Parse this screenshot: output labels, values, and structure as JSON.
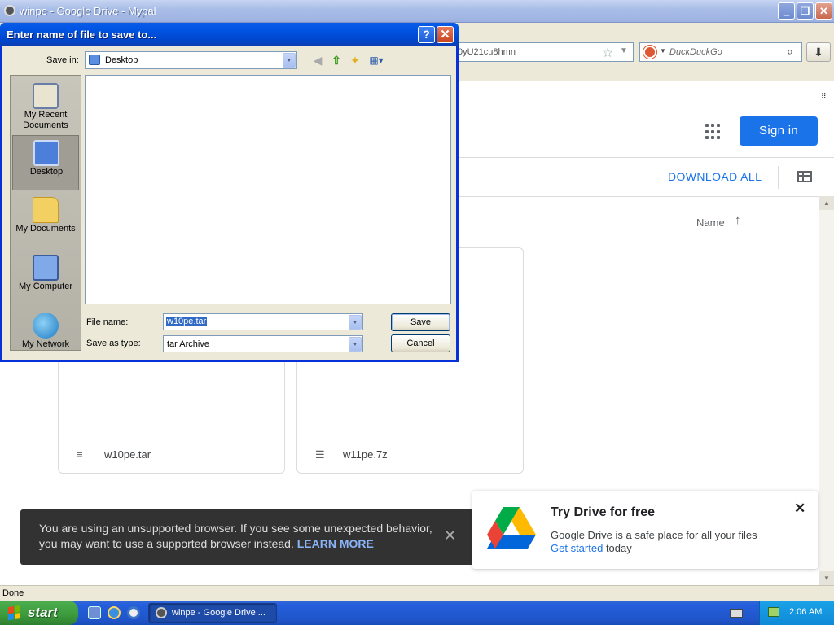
{
  "browser": {
    "title": "winpe - Google Drive - Mypal",
    "minimize_icon": "minimize-icon",
    "maximize_icon": "maximize-icon",
    "close_icon": "close-icon",
    "url_partial": "0yU21cu8hmn",
    "search_placeholder": "DuckDuckGo",
    "status_text": "Done"
  },
  "drive": {
    "signin_label": "Sign in",
    "download_all_label": "DOWNLOAD ALL",
    "sort_label": "Name",
    "sort_arrow": "↑",
    "files": [
      {
        "name": "w10pe.tar",
        "icon": "archive-icon"
      },
      {
        "name": "w11pe.7z",
        "icon": "list-file-icon"
      }
    ],
    "toast": {
      "text": "You are using an unsupported browser. If you see some unexpected behavior, you may want to use a supported browser instead.",
      "link": "LEARN MORE",
      "close": "✕"
    },
    "promo": {
      "title": "Try Drive for free",
      "description": "Google Drive is a safe place for all your files",
      "link": "Get started",
      "link_suffix": "today",
      "close": "✕",
      "logo_colors": [
        "#0066da",
        "#00ac47",
        "#ea4335",
        "#ffba00"
      ]
    }
  },
  "dialog": {
    "title": "Enter name of file to save to...",
    "help": "?",
    "close": "✕",
    "save_in_label": "Save in:",
    "save_in_value": "Desktop",
    "places": [
      {
        "label": "My Recent Documents",
        "selected": false
      },
      {
        "label": "Desktop",
        "selected": true
      },
      {
        "label": "My Documents",
        "selected": false
      },
      {
        "label": "My Computer",
        "selected": false
      },
      {
        "label": "My Network",
        "selected": false
      }
    ],
    "file_name_label": "File name:",
    "file_name_value": "w10pe.tar",
    "save_as_type_label": "Save as type:",
    "save_as_type_value": "tar Archive",
    "save_label": "Save",
    "cancel_label": "Cancel"
  },
  "taskbar": {
    "start_label": "start",
    "task_label": "winpe - Google Drive ...",
    "clock": "2:06 AM"
  },
  "colors": {
    "xp_blue": "#0054e3",
    "drive_blue": "#1a73e8",
    "start_green": "#3c9a3c"
  }
}
